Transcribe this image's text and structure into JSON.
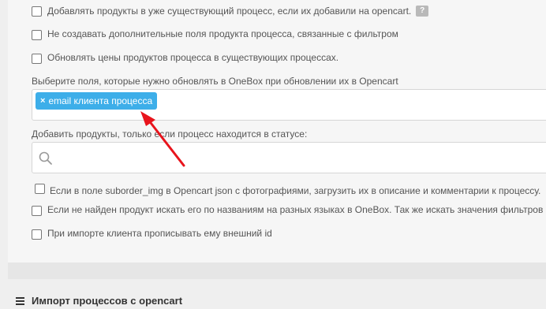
{
  "options": {
    "add_existing": "Добавлять продукты в уже существующий процесс, если их добавили на opencart.",
    "help_mark": "?",
    "no_filter_fields": "Не создавать дополнительные поля продукта процесса, связанные с фильтром",
    "update_prices": "Обновлять цены продуктов процесса в существующих процессах.",
    "fields_label": "Выберите поля, которые нужно обновлять в OneBox при обновлении их в Opencart",
    "tag_remove": "×",
    "tag_label": "email клиента процесса",
    "status_label": "Добавить продукты, только если процесс находится в статусе:",
    "suborder_img": "Если в поле suborder_img в Opencart json с фотографиями, загрузить их в описание и комментарии к процессу.",
    "search_by_name": "Если не найден продукт искать его по названиям на разных языках в OneBox. Так же искать значения фильтров н",
    "external_id": "При импорте клиента прописывать ему внешний id"
  },
  "section": {
    "title": "Импорт процессов с opencart"
  },
  "colors": {
    "tag": "#3daee9",
    "arrow": "#e8141c"
  },
  "icons": {
    "search": "search-icon",
    "menu": "hamburger-icon",
    "arrow": "red-arrow"
  }
}
